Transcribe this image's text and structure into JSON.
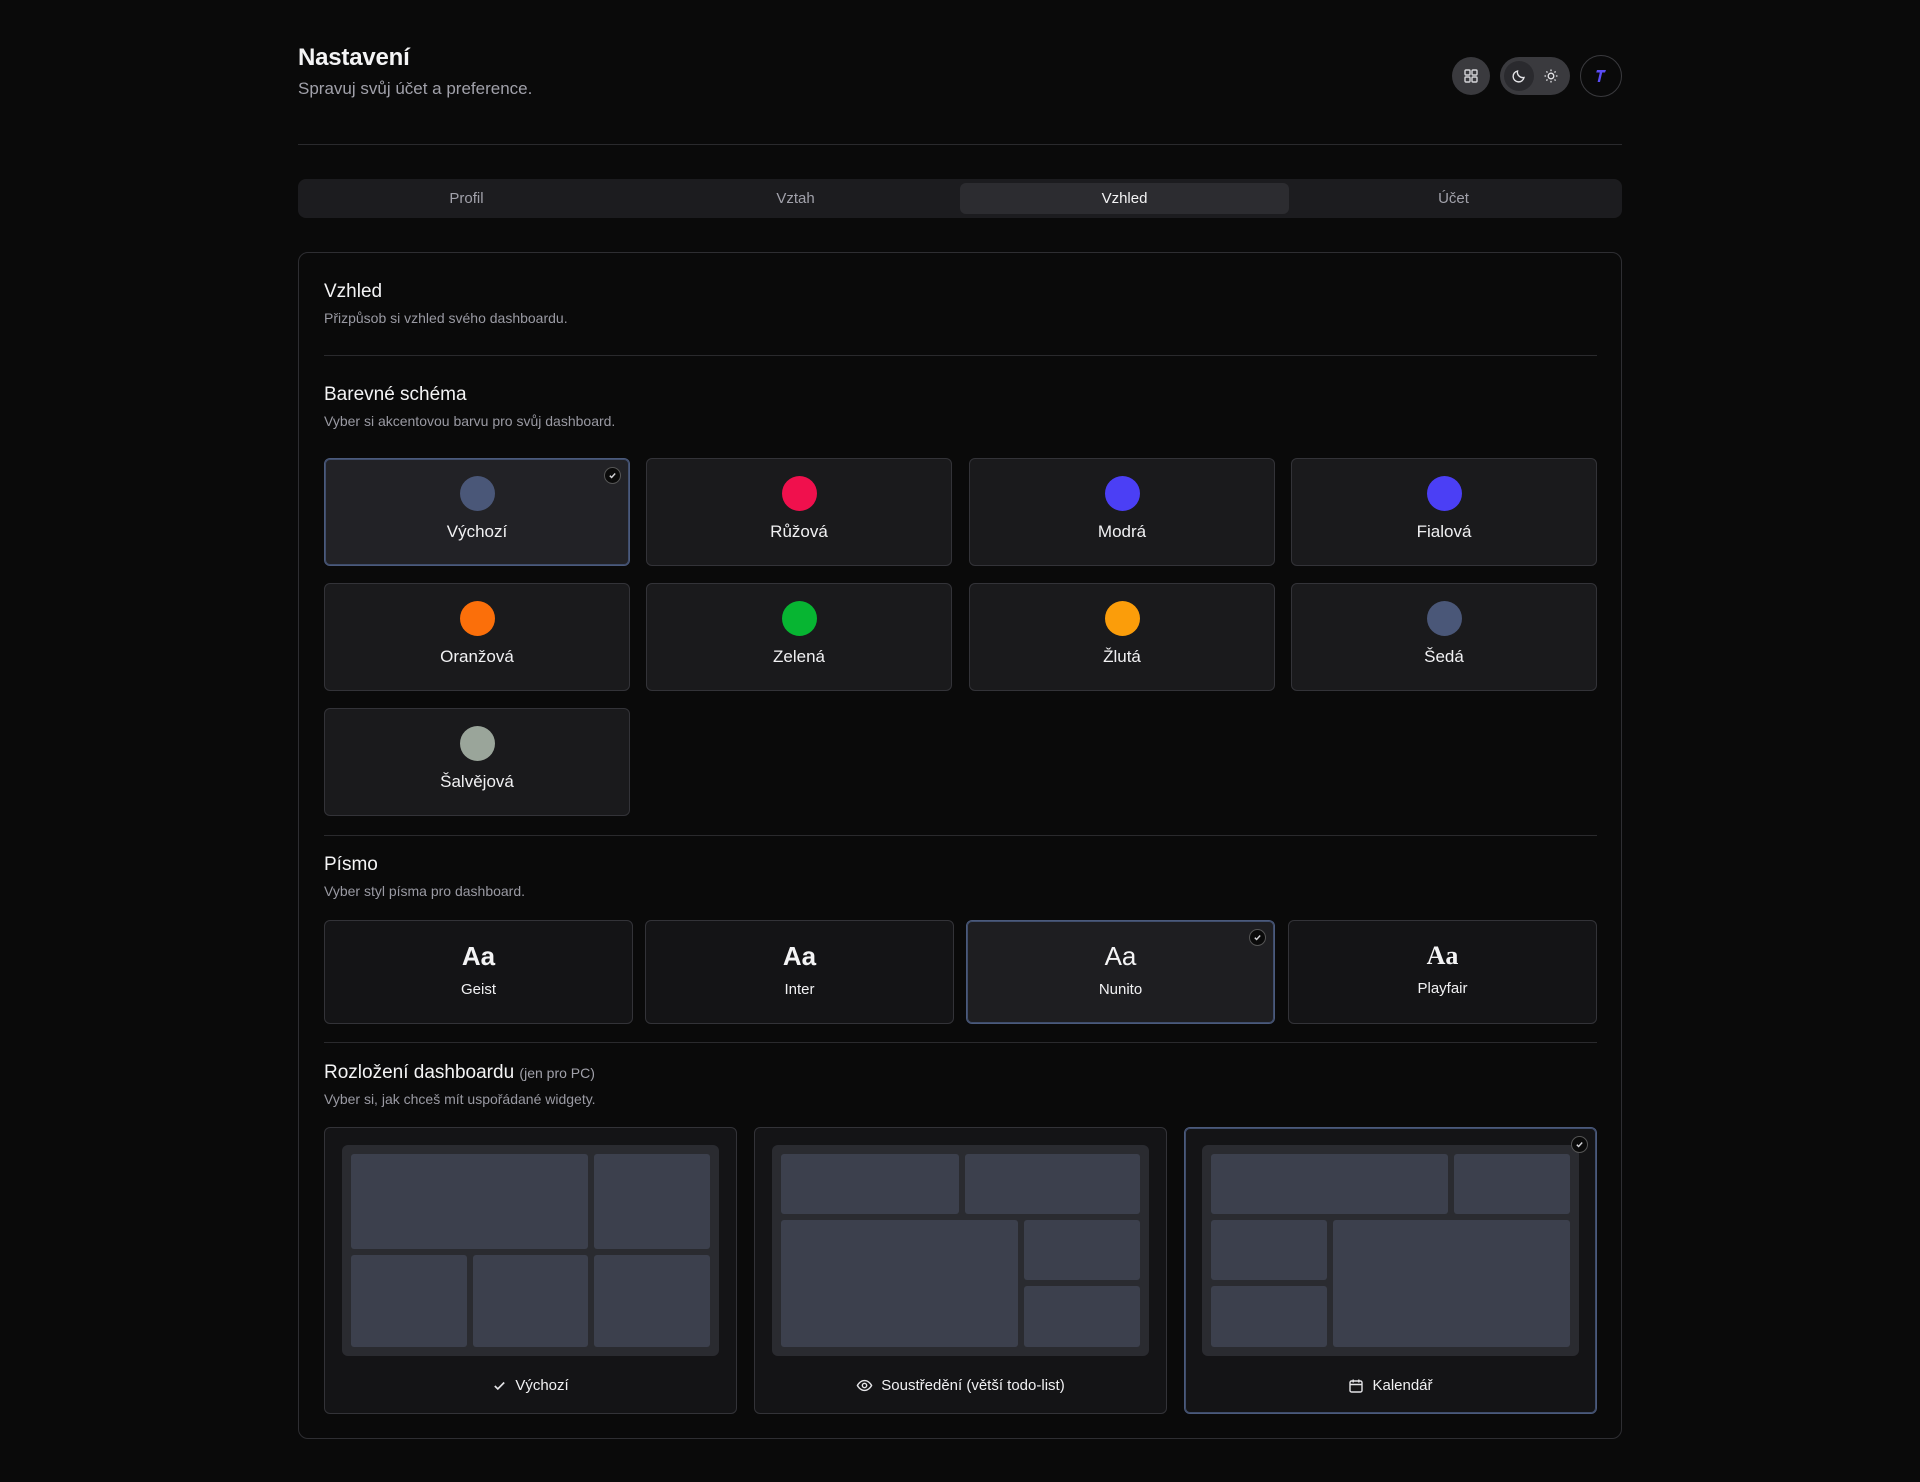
{
  "header": {
    "title": "Nastavení",
    "subtitle": "Spravuj svůj účet a preference.",
    "grid_icon": "grid-icon",
    "theme_icons": [
      "moon-icon",
      "sun-icon"
    ],
    "avatar_icon": "logo-icon"
  },
  "tabs": [
    {
      "label": "Profil",
      "active": false
    },
    {
      "label": "Vztah",
      "active": false
    },
    {
      "label": "Vzhled",
      "active": true
    },
    {
      "label": "Účet",
      "active": false
    }
  ],
  "appearance": {
    "title": "Vzhled",
    "description": "Přizpůsob si vzhled svého dashboardu."
  },
  "color_scheme": {
    "title": "Barevné schéma",
    "description": "Vyber si akcentovou barvu pro svůj dashboard.",
    "selected": "Výchozí",
    "options": [
      {
        "label": "Výchozí",
        "color": "#4a5778"
      },
      {
        "label": "Růžová",
        "color": "#f0104d"
      },
      {
        "label": "Modrá",
        "color": "#4b3ff5"
      },
      {
        "label": "Fialová",
        "color": "#4b3ff5"
      },
      {
        "label": "Oranžová",
        "color": "#fb6f0a"
      },
      {
        "label": "Zelená",
        "color": "#07b532"
      },
      {
        "label": "Žlutá",
        "color": "#fb9d0a"
      },
      {
        "label": "Šedá",
        "color": "#4a5778"
      },
      {
        "label": "Šalvějová",
        "color": "#9aa59a"
      }
    ]
  },
  "font": {
    "title": "Písmo",
    "description": "Vyber styl písma pro dashboard.",
    "sample": "Aa",
    "selected": "Nunito",
    "options": [
      {
        "label": "Geist"
      },
      {
        "label": "Inter"
      },
      {
        "label": "Nunito"
      },
      {
        "label": "Playfair"
      }
    ]
  },
  "layout": {
    "title": "Rozložení dashboardu",
    "title_note": "(jen pro PC)",
    "description": "Vyber si, jak chceš mít uspořádané widgety.",
    "selected": "Kalendář",
    "options": [
      {
        "label": "Výchozí",
        "icon": "check-icon"
      },
      {
        "label": "Soustředění (větší todo-list)",
        "icon": "eye-icon"
      },
      {
        "label": "Kalendář",
        "icon": "calendar-icon"
      }
    ]
  }
}
